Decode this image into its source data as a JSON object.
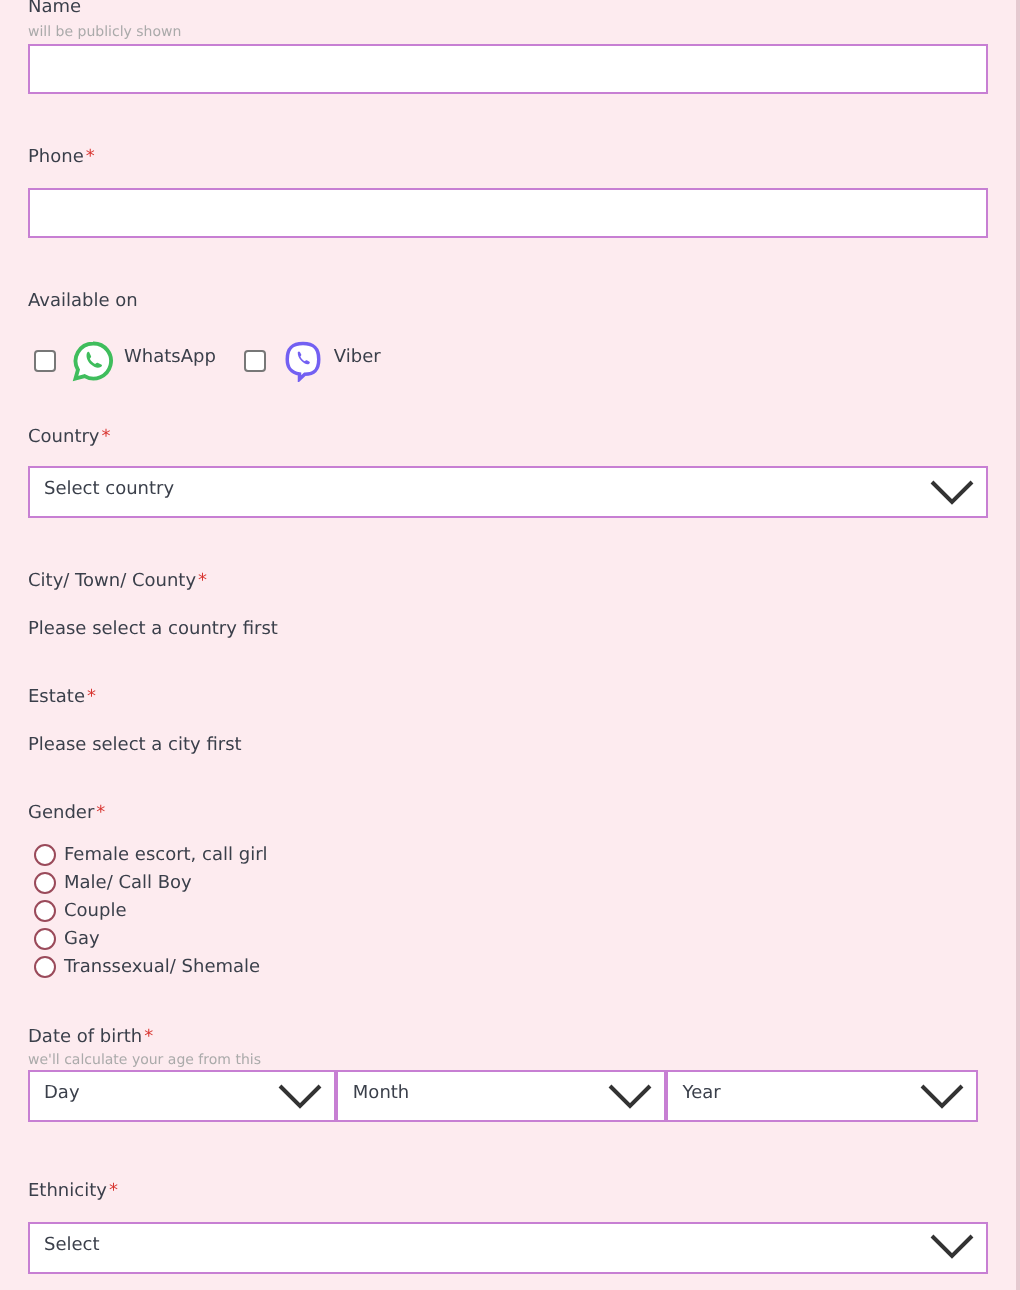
{
  "fields": [
    {
      "kind": "text",
      "label": "Name",
      "hint": "will be publicly shown"
    },
    {
      "kind": "text",
      "label": "Phone",
      "asterisk": "*"
    },
    {
      "kind": "checkboxes",
      "label": "Available on",
      "options": [
        {
          "label": "WhatsApp",
          "checked": false
        },
        {
          "label": "Viber",
          "checked": false
        }
      ]
    },
    {
      "kind": "select",
      "label": "Country",
      "asterisk": "*",
      "value": "Select country"
    },
    {
      "kind": "note",
      "label": "City/ Town/ County",
      "asterisk": "*",
      "note": "Please select a country first"
    },
    {
      "kind": "note",
      "label": "Estate",
      "asterisk": "*",
      "note": "Please select a city first"
    },
    {
      "kind": "radios",
      "label": "Gender",
      "asterisk": "*",
      "options": [
        {
          "label": "Female escort, call girl",
          "selected": false
        },
        {
          "label": "Male/ Call Boy",
          "selected": false
        },
        {
          "label": "Couple",
          "selected": false
        },
        {
          "label": "Gay",
          "selected": false
        },
        {
          "label": "Transsexual/ Shemale",
          "selected": false
        }
      ]
    },
    {
      "kind": "date",
      "label": "Date of birth",
      "asterisk": "*",
      "hint": "we'll calculate your age from this",
      "parts": [
        "Day",
        "Month",
        "Year"
      ]
    },
    {
      "kind": "select",
      "label": "Ethnicity",
      "asterisk": "*",
      "value": "Select"
    }
  ]
}
